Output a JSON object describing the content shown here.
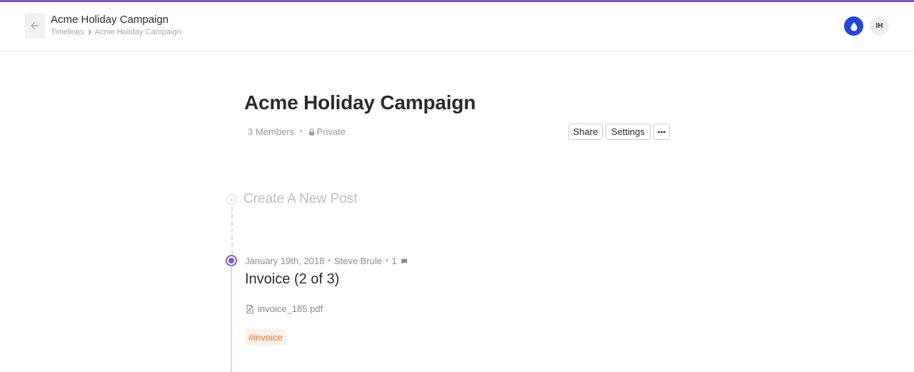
{
  "header": {
    "title": "Acme Holiday Campaign",
    "breadcrumb": [
      "Timelines",
      "Acme Holiday Campaign"
    ],
    "avatar_initials": "IH"
  },
  "colors": {
    "accent": "#7d5cc4",
    "logo": "#2447d8",
    "tag_text": "#e0793a",
    "tag_bg": "#fdf1e9"
  },
  "timeline": {
    "title": "Acme Holiday Campaign",
    "members": "3 Members",
    "privacy": "Private",
    "actions": {
      "share": "Share",
      "settings": "Settings",
      "more": "•••"
    }
  },
  "create_post": {
    "label": "Create A New Post"
  },
  "posts": [
    {
      "date": "January 19th, 2018",
      "author": "Steve Brule",
      "comment_count": "1",
      "title": "Invoice (2 of 3)",
      "attachment": "invoice_185.pdf",
      "tag": "#invoice"
    }
  ]
}
